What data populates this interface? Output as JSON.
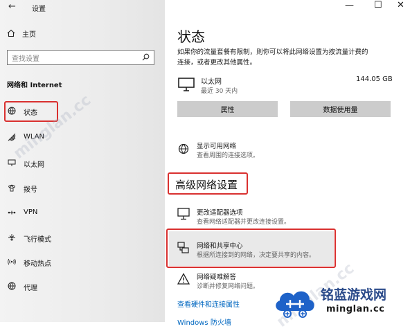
{
  "window": {
    "title": "设置",
    "back_icon": "arrow-left-icon",
    "controls": {
      "minimize": "—",
      "maximize": "☐",
      "close": "✕"
    }
  },
  "sidebar": {
    "home_label": "主页",
    "search_placeholder": "查找设置",
    "section_title": "网络和 Internet",
    "items": [
      {
        "label": "状态",
        "icon": "status-globe-icon",
        "selected": true
      },
      {
        "label": "WLAN",
        "icon": "wifi-icon"
      },
      {
        "label": "以太网",
        "icon": "ethernet-icon"
      },
      {
        "label": "拨号",
        "icon": "dialup-icon"
      },
      {
        "label": "VPN",
        "icon": "vpn-icon"
      },
      {
        "label": "飞行模式",
        "icon": "airplane-icon"
      },
      {
        "label": "移动热点",
        "icon": "hotspot-icon"
      },
      {
        "label": "代理",
        "icon": "globe-icon"
      }
    ]
  },
  "main": {
    "title": "状态",
    "description_line1": "如果你的流量套餐有限制，则你可以将此网络设置为按流量计费的",
    "description_line2": "连接，或者更改其他属性。",
    "network": {
      "name": "以太网",
      "sub": "最近 30 天内",
      "usage": "144.05 GB"
    },
    "buttons": {
      "properties": "属性",
      "data_usage": "数据使用量"
    },
    "show_networks": {
      "title": "显示可用网络",
      "sub": "查看周围的连接选项。"
    },
    "advanced_title": "高级网络设置",
    "adapter": {
      "title": "更改适配器选项",
      "sub": "查看网络适配器并更改连接设置。"
    },
    "sharing": {
      "title": "网络和共享中心",
      "sub": "根据所连接到的网络，决定要共享的内容。"
    },
    "troubleshoot": {
      "title": "网络疑难解答",
      "sub": "诊断并修复网络问题。"
    },
    "hw_link": "查看硬件和连接属性",
    "firewall_link": "Windows 防火墙"
  },
  "branding": {
    "cn": "铭蓝游戏网",
    "en": "minglan.cc",
    "watermark": "minglan.cc"
  },
  "colors": {
    "accent": "#0067c0",
    "highlight": "#d9302f",
    "button": "#cccccc"
  }
}
